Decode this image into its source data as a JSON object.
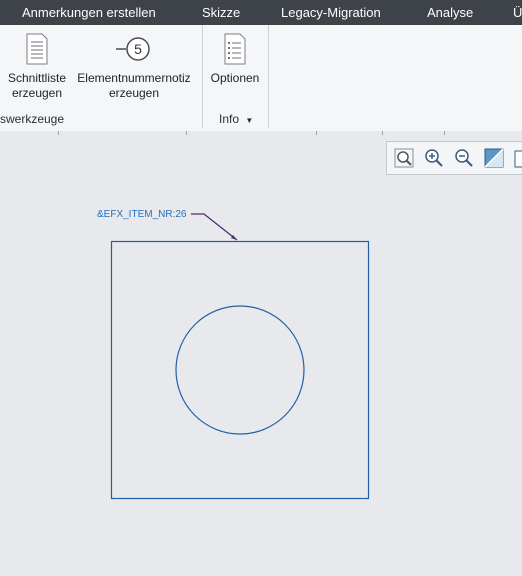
{
  "menubar": {
    "tabs": [
      "Anmerkungen erstellen",
      "Skizze",
      "Legacy-Migration",
      "Analyse",
      "Ü"
    ]
  },
  "ribbon": {
    "buttons": {
      "schnittliste": "Schnittliste\nerzeugen",
      "elementnummer": "Elementnummernotiz\nerzeugen",
      "optionen": "Optionen"
    },
    "groups": {
      "werkzeuge": "swerkzeuge",
      "info": "Info"
    }
  },
  "canvas": {
    "note_label": "&EFX_ITEM_NR:26"
  },
  "colors": {
    "menubar_bg": "#3d4348",
    "geometry": "#1f5fa8",
    "leader": "#4b2a72",
    "note_text": "#1f6fbf"
  },
  "icons": [
    "list-icon",
    "balloon-5-icon",
    "options-icon",
    "zoom-fit-icon",
    "zoom-in-icon",
    "zoom-out-icon",
    "view-toggle-icon",
    "paper-icon"
  ]
}
